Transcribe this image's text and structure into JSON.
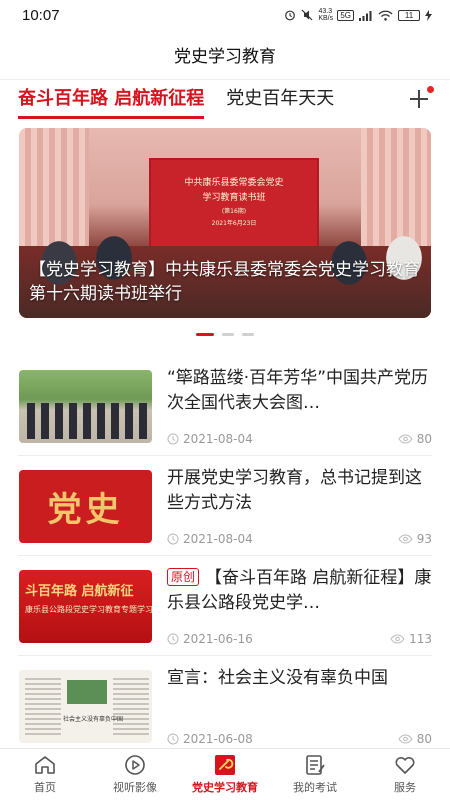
{
  "status_bar": {
    "time": "10:07",
    "speed": "43.3",
    "speed_unit": "KB/s",
    "network": "5G",
    "battery": "11"
  },
  "header": {
    "title": "党史学习教育"
  },
  "tabs": {
    "items": [
      {
        "label": "奋斗百年路 启航新征程",
        "active": true
      },
      {
        "label": "党史百年天天"
      }
    ]
  },
  "banner": {
    "caption": "【党史学习教育】中共康乐县委常委会党史学习教育第十六期读书班举行",
    "stage_lines": [
      "中共康乐县委常委会党史",
      "学习教育读书班",
      "(第16期)",
      "2021年6月23日"
    ],
    "slide_count": 3
  },
  "news": [
    {
      "title": "“筚路蓝缕·百年芳华”中国共产党历次全国代表大会图…",
      "date": "2021-08-04",
      "views": "80",
      "tag": ""
    },
    {
      "title": "开展党史学习教育，总书记提到这些方式方法",
      "date": "2021-08-04",
      "views": "93",
      "tag": "",
      "thumb_text": "党史"
    },
    {
      "title": "【奋斗百年路 启航新征程】康乐县公路段党史学…",
      "date": "2021-06-16",
      "views": "113",
      "tag": "原创",
      "thumb_text": "斗百年路 启航新征",
      "thumb_sub": "康乐县公路段党史学习教育专题学习"
    },
    {
      "title": "宣言：社会主义没有辜负中国",
      "date": "2021-06-08",
      "views": "80",
      "tag": "",
      "thumb_text": "社会主义没有辜负中国"
    }
  ],
  "bottom_nav": [
    {
      "label": "首页",
      "icon": "home-icon"
    },
    {
      "label": "视听影像",
      "icon": "play-icon"
    },
    {
      "label": "党史学习教育",
      "icon": "party-emblem-icon",
      "active": true
    },
    {
      "label": "我的考试",
      "icon": "exam-icon"
    },
    {
      "label": "服务",
      "icon": "heart-icon"
    }
  ],
  "colors": {
    "accent": "#d7141e",
    "muted_text": "#999999"
  }
}
